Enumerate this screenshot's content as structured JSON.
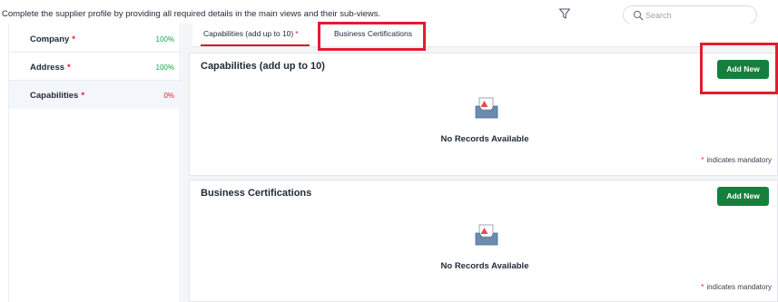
{
  "header": {
    "instructions": "Complete the supplier profile by providing all required details in the main views and their sub-views.",
    "search_placeholder": "Search"
  },
  "sidebar": {
    "items": [
      {
        "label": "Company",
        "required": "*",
        "percent": "100%",
        "percent_color": "#16a34a"
      },
      {
        "label": "Address",
        "required": "*",
        "percent": "100%",
        "percent_color": "#16a34a"
      },
      {
        "label": "Capabilities",
        "required": "*",
        "percent": "0%",
        "percent_color": "#e11d2e"
      }
    ]
  },
  "tabs": [
    {
      "label": "Capabilities (add up to 10)",
      "required": "*",
      "active": true
    },
    {
      "label": "Business Certifications",
      "active": false
    }
  ],
  "sections": [
    {
      "title": "Capabilities (add up to 10)",
      "add_label": "Add New",
      "empty_text": "No Records Available",
      "mandatory_text": "indicates mandatory",
      "mandatory_star": "*"
    },
    {
      "title": "Business Certifications",
      "add_label": "Add New",
      "empty_text": "No Records Available",
      "mandatory_text": "indicates mandatory",
      "mandatory_star": "*"
    }
  ],
  "colors": {
    "accent_red": "#e11d2e",
    "button_green": "#15803d",
    "success_green": "#16a34a"
  }
}
